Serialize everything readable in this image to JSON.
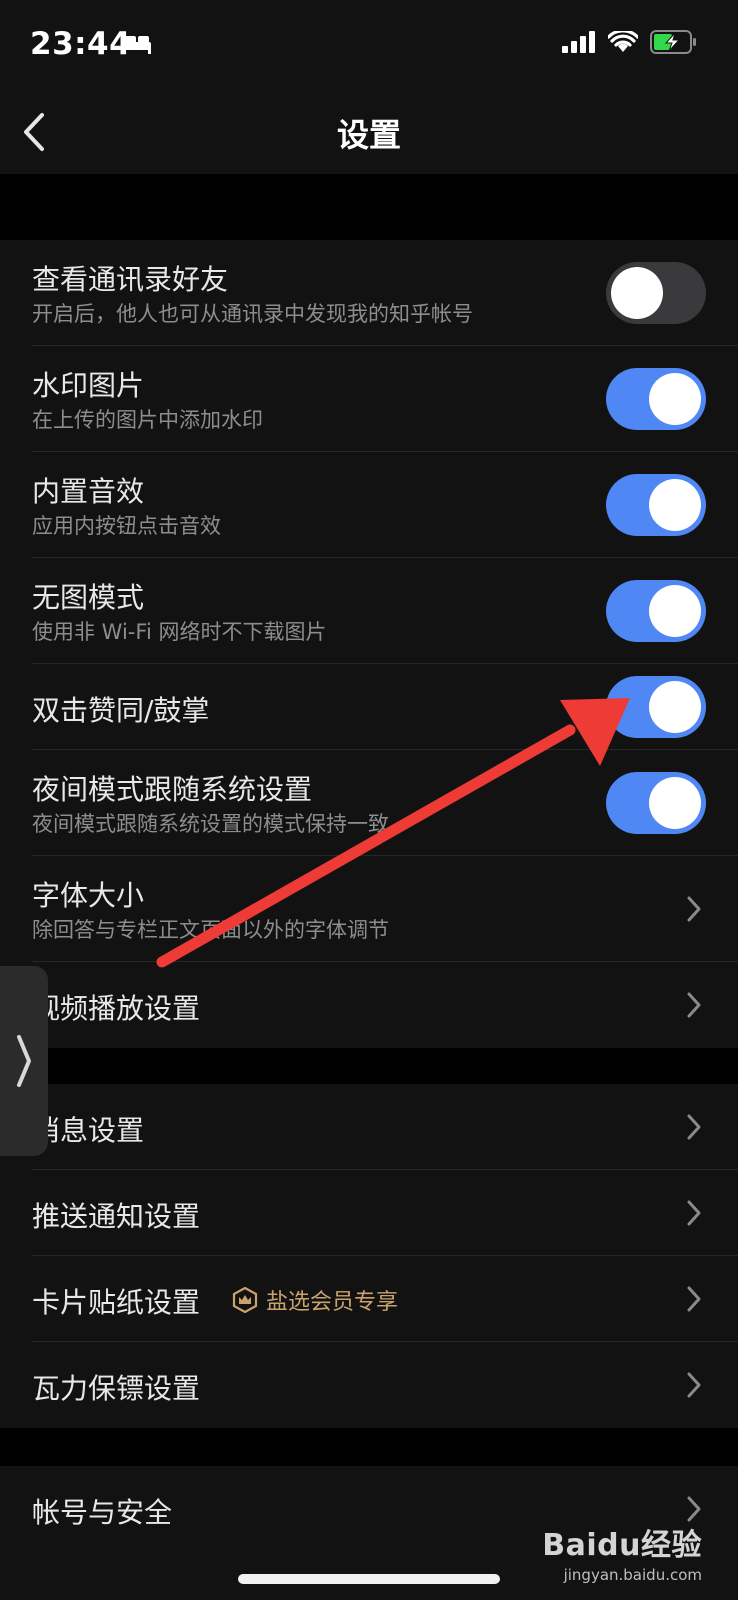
{
  "status": {
    "time": "23:44"
  },
  "nav": {
    "title": "设置"
  },
  "group1": [
    {
      "title": "查看通讯录好友",
      "subtitle": "开启后，他人也可从通讯录中发现我的知乎帐号",
      "toggle": "off"
    },
    {
      "title": "水印图片",
      "subtitle": "在上传的图片中添加水印",
      "toggle": "on"
    },
    {
      "title": "内置音效",
      "subtitle": "应用内按钮点击音效",
      "toggle": "on"
    },
    {
      "title": "无图模式",
      "subtitle": "使用非 Wi-Fi 网络时不下载图片",
      "toggle": "on"
    },
    {
      "title": "双击赞同/鼓掌",
      "toggle": "on"
    },
    {
      "title": "夜间模式跟随系统设置",
      "subtitle": "夜间模式跟随系统设置的模式保持一致",
      "toggle": "on"
    },
    {
      "title": "字体大小",
      "subtitle": "除回答与专栏正文页面以外的字体调节"
    },
    {
      "title": "视频播放设置"
    }
  ],
  "group2": [
    {
      "title": "消息设置"
    },
    {
      "title": "推送通知设置"
    },
    {
      "title": "卡片贴纸设置",
      "badge": "盐选会员专享"
    },
    {
      "title": "瓦力保镖设置"
    }
  ],
  "group3": [
    {
      "title": "帐号与安全"
    }
  ],
  "watermark": {
    "logo": "Baidu经验",
    "url": "jingyan.baidu.com"
  },
  "colors": {
    "toggle_on": "#4f87f5",
    "toggle_off": "#3a3a3c",
    "vip_gold": "#c9a36b",
    "annotation_arrow": "#ef3b36"
  }
}
